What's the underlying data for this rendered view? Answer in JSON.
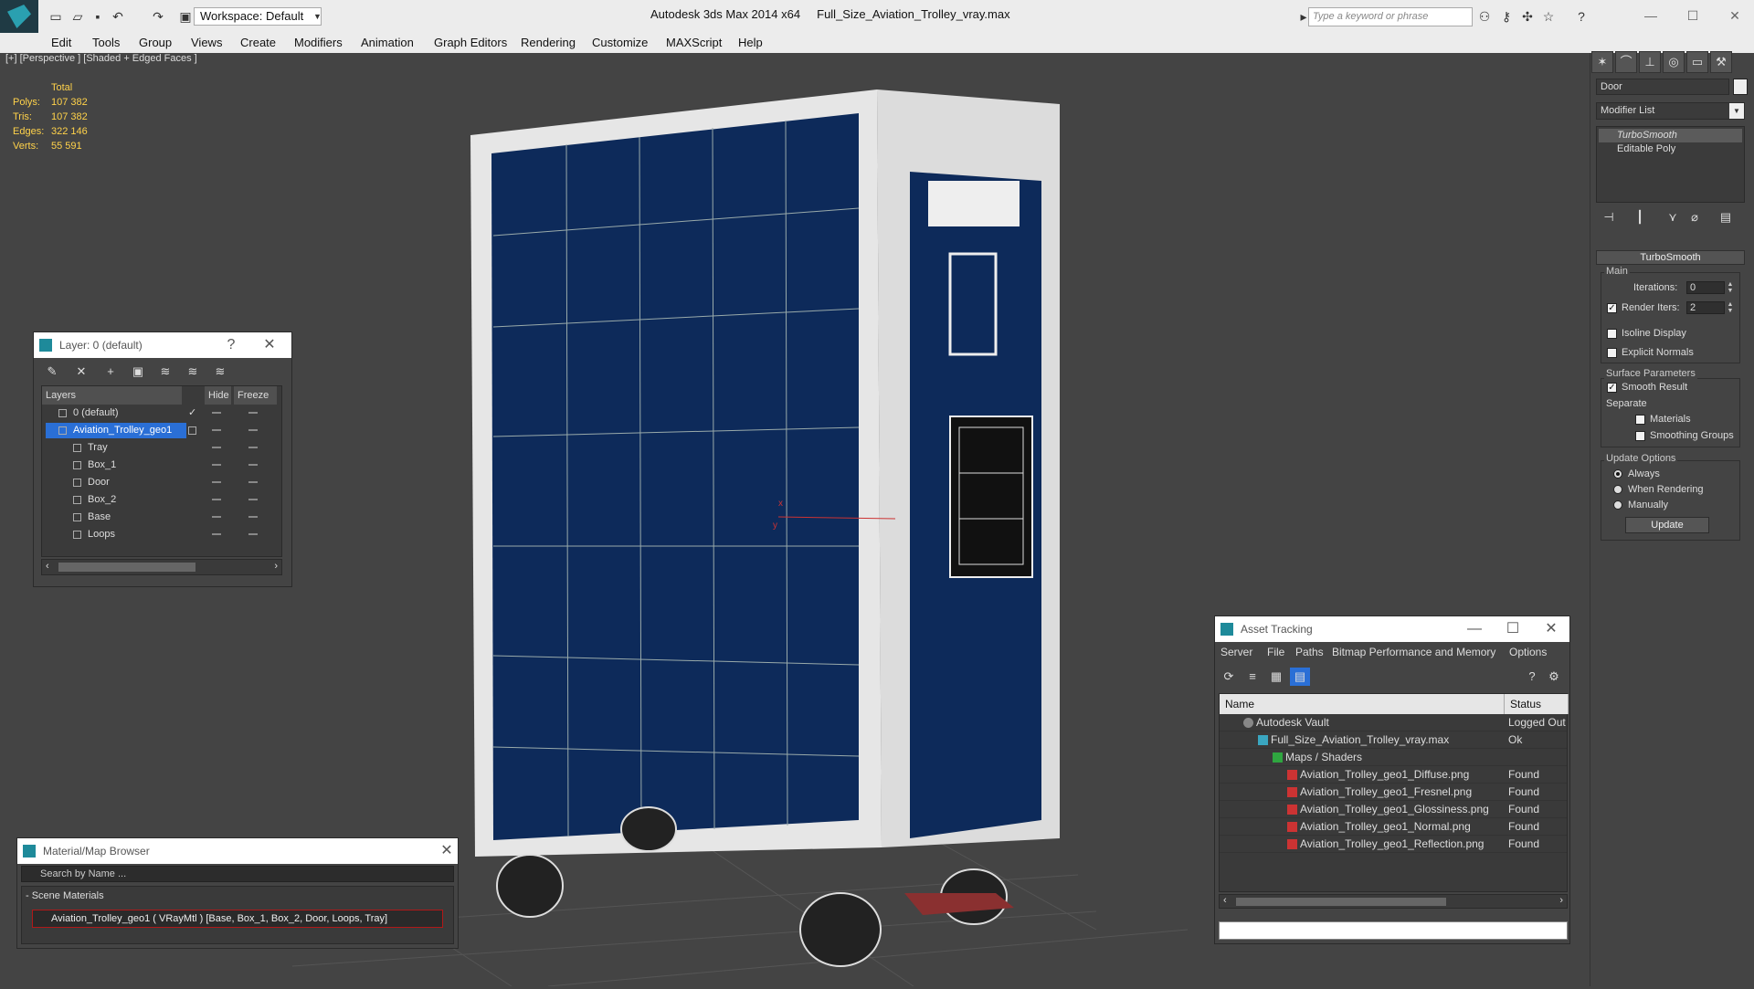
{
  "app": {
    "title": "Autodesk 3ds Max  2014 x64",
    "file": "Full_Size_Aviation_Trolley_vray.max",
    "workspace": "Workspace: Default",
    "search_placeholder": "Type a keyword or phrase"
  },
  "menu": [
    "Edit",
    "Tools",
    "Group",
    "Views",
    "Create",
    "Modifiers",
    "Animation",
    "Graph Editors",
    "Rendering",
    "Customize",
    "MAXScript",
    "Help"
  ],
  "viewport": {
    "label": "[+] [Perspective ] [Shaded + Edged Faces ]",
    "stats": {
      "header": "Total",
      "rows": [
        {
          "label": "Polys:",
          "value": "107 382"
        },
        {
          "label": "Tris:",
          "value": "107 382"
        },
        {
          "label": "Edges:",
          "value": "322 146"
        },
        {
          "label": "Verts:",
          "value": "55 591"
        }
      ]
    },
    "axis_x": "x",
    "axis_y": "y"
  },
  "command_panel": {
    "object_name": "Door",
    "modifier_list": "Modifier List",
    "stack": [
      "TurboSmooth",
      "Editable Poly"
    ],
    "rollout_title": "TurboSmooth",
    "main_group": "Main",
    "iterations_label": "Iterations:",
    "iterations_value": "0",
    "render_iters_label": "Render Iters:",
    "render_iters_value": "2",
    "isoline": "Isoline Display",
    "explicit_normals": "Explicit Normals",
    "surface_group": "Surface Parameters",
    "smooth_result": "Smooth Result",
    "separate": "Separate",
    "materials": "Materials",
    "smoothing_groups": "Smoothing Groups",
    "update_group": "Update Options",
    "always": "Always",
    "when_rendering": "When Rendering",
    "manually": "Manually",
    "update_button": "Update"
  },
  "layer_dialog": {
    "title": "Layer: 0 (default)",
    "help": "?",
    "col_layers": "Layers",
    "col_hide": "Hide",
    "col_freeze": "Freeze",
    "rows": [
      "0 (default)",
      "Aviation_Trolley_geo1",
      "Tray",
      "Box_1",
      "Door",
      "Box_2",
      "Base",
      "Loops"
    ]
  },
  "material_browser": {
    "title": "Material/Map Browser",
    "search_placeholder": "Search by Name ...",
    "section": "- Scene Materials",
    "material": "Aviation_Trolley_geo1  ( VRayMtl )  [Base, Box_1, Box_2, Door, Loops, Tray]"
  },
  "asset_tracking": {
    "title": "Asset Tracking",
    "menu": [
      "Server",
      "File",
      "Paths",
      "Bitmap Performance and Memory",
      "Options"
    ],
    "col_name": "Name",
    "col_status": "Status",
    "rows": [
      {
        "name": "Autodesk Vault",
        "status": "Logged Out"
      },
      {
        "name": "Full_Size_Aviation_Trolley_vray.max",
        "status": "Ok"
      },
      {
        "name": "Maps / Shaders",
        "status": ""
      },
      {
        "name": "Aviation_Trolley_geo1_Diffuse.png",
        "status": "Found"
      },
      {
        "name": "Aviation_Trolley_geo1_Fresnel.png",
        "status": "Found"
      },
      {
        "name": "Aviation_Trolley_geo1_Glossiness.png",
        "status": "Found"
      },
      {
        "name": "Aviation_Trolley_geo1_Normal.png",
        "status": "Found"
      },
      {
        "name": "Aviation_Trolley_geo1_Reflection.png",
        "status": "Found"
      }
    ]
  },
  "colors": {
    "trolley_panel": "#0d2a5a",
    "wire": "#e8e8e8",
    "stats": "#ffd24a",
    "selection": "#2a6fd6"
  }
}
